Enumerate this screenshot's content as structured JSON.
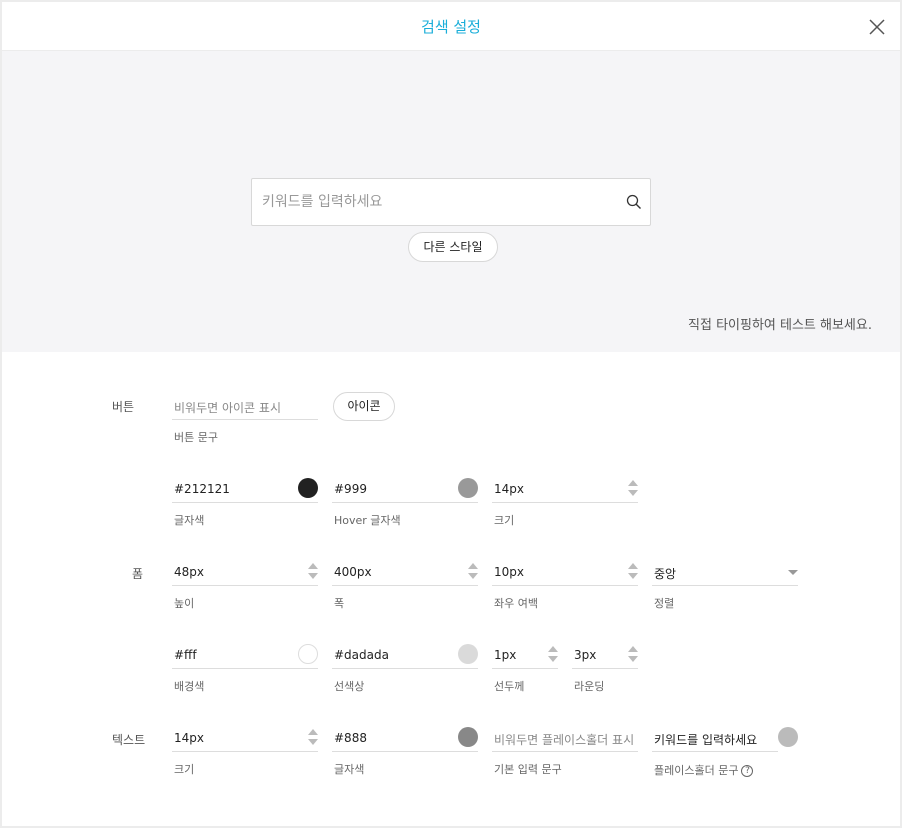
{
  "header": {
    "title": "검색 설정",
    "close_icon": "close-icon"
  },
  "preview": {
    "search_placeholder": "키워드를 입력하세요",
    "other_style_label": "다른 스타일",
    "hint": "직접 타이핑하여 테스트 해보세요."
  },
  "button_section": {
    "label": "버튼",
    "text_field": {
      "value": "비워두면 아이콘 표시",
      "caption": "버튼 문구"
    },
    "icon_button_label": "아이콘",
    "text_color": {
      "value": "#212121",
      "caption": "글자색",
      "swatch": "#212121"
    },
    "hover_color": {
      "value": "#999",
      "caption": "Hover 글자색",
      "swatch": "#999999"
    },
    "size": {
      "value": "14px",
      "caption": "크기"
    }
  },
  "form_section": {
    "label": "폼",
    "height": {
      "value": "48px",
      "caption": "높이"
    },
    "width": {
      "value": "400px",
      "caption": "폭"
    },
    "padding": {
      "value": "10px",
      "caption": "좌우 여백"
    },
    "align": {
      "value": "중앙",
      "caption": "정렬"
    },
    "bg_color": {
      "value": "#fff",
      "caption": "배경색",
      "swatch": "#ffffff"
    },
    "line_color": {
      "value": "#dadada",
      "caption": "선색상",
      "swatch": "#dadada"
    },
    "line_width": {
      "value": "1px",
      "caption": "선두께"
    },
    "radius": {
      "value": "3px",
      "caption": "라운딩"
    }
  },
  "text_section": {
    "label": "텍스트",
    "size": {
      "value": "14px",
      "caption": "크기"
    },
    "color": {
      "value": "#888",
      "caption": "글자색",
      "swatch": "#888888"
    },
    "default_text": {
      "value": "비워두면 플레이스홀더 표시",
      "caption": "기본 입력 문구"
    },
    "placeholder": {
      "value": "키워드를 입력하세요",
      "caption": "플레이스홀더 문구",
      "swatch": "#bbbbbb",
      "help": "?"
    }
  }
}
